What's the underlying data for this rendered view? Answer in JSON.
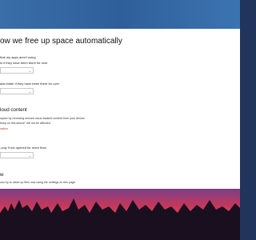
{
  "page": {
    "heading": "ow we free up space automatically"
  },
  "temp_files": {
    "apps_text": "that my apps aren't using",
    "recycle_text": "in if they have been there for over",
    "downloads_text": "ads folder if they have been there for over"
  },
  "cloud": {
    "title": "loud content",
    "desc_line1": "space by removing unused cloud-backed content from your device.",
    "desc_line2": "keep on this device\" will not be affected.",
    "link": "nation",
    "online_only_text": "-only if not opened for more than"
  },
  "now": {
    "title": "w",
    "desc": "can try to clean up files now using the settings on this page."
  }
}
